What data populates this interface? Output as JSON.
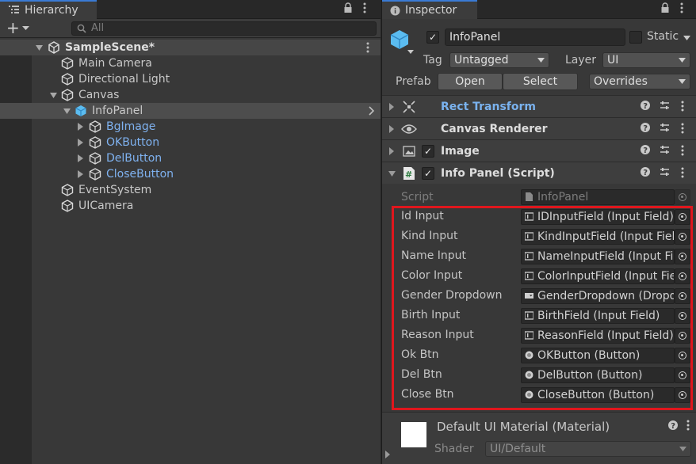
{
  "hierarchy": {
    "tab_label": "Hierarchy",
    "add_button": "+",
    "search_placeholder": "All",
    "scene": "SampleScene*",
    "items": [
      {
        "label": "Main Camera"
      },
      {
        "label": "Directional Light"
      },
      {
        "label": "Canvas"
      },
      {
        "label": "InfoPanel"
      },
      {
        "label": "BgImage"
      },
      {
        "label": "OKButton"
      },
      {
        "label": "DelButton"
      },
      {
        "label": "CloseButton"
      },
      {
        "label": "EventSystem"
      },
      {
        "label": "UICamera"
      }
    ]
  },
  "inspector": {
    "tab_label": "Inspector",
    "object_name": "InfoPanel",
    "static_label": "Static",
    "tag_label": "Tag",
    "tag_value": "Untagged",
    "layer_label": "Layer",
    "layer_value": "UI",
    "prefab_label": "Prefab",
    "prefab_open": "Open",
    "prefab_select": "Select",
    "prefab_overrides": "Overrides",
    "components": [
      {
        "title": "Rect Transform"
      },
      {
        "title": "Canvas Renderer"
      },
      {
        "title": "Image"
      },
      {
        "title": "Info Panel (Script)"
      }
    ],
    "script_label": "Script",
    "script_value": "InfoPanel",
    "fields": [
      {
        "label": "Id Input",
        "value": "IDInputField (Input Field)"
      },
      {
        "label": "Kind Input",
        "value": "KindInputField (Input Field)"
      },
      {
        "label": "Name Input",
        "value": "NameInputField (Input Field)"
      },
      {
        "label": "Color Input",
        "value": "ColorInputField (Input Field)"
      },
      {
        "label": "Gender Dropdown",
        "value": "GenderDropdown (Dropdown)"
      },
      {
        "label": "Birth Input",
        "value": "BirthField (Input Field)"
      },
      {
        "label": "Reason Input",
        "value": "ReasonField (Input Field)"
      },
      {
        "label": "Ok Btn",
        "value": "OKButton (Button)"
      },
      {
        "label": "Del Btn",
        "value": "DelButton (Button)"
      },
      {
        "label": "Close Btn",
        "value": "CloseButton (Button)"
      }
    ],
    "material_title": "Default UI Material (Material)",
    "shader_label": "Shader",
    "shader_value": "UI/Default"
  },
  "colors": {
    "link_blue": "#7fb2f0",
    "highlight_red": "#e0161d",
    "tab_accent": "#3a7bd5"
  }
}
